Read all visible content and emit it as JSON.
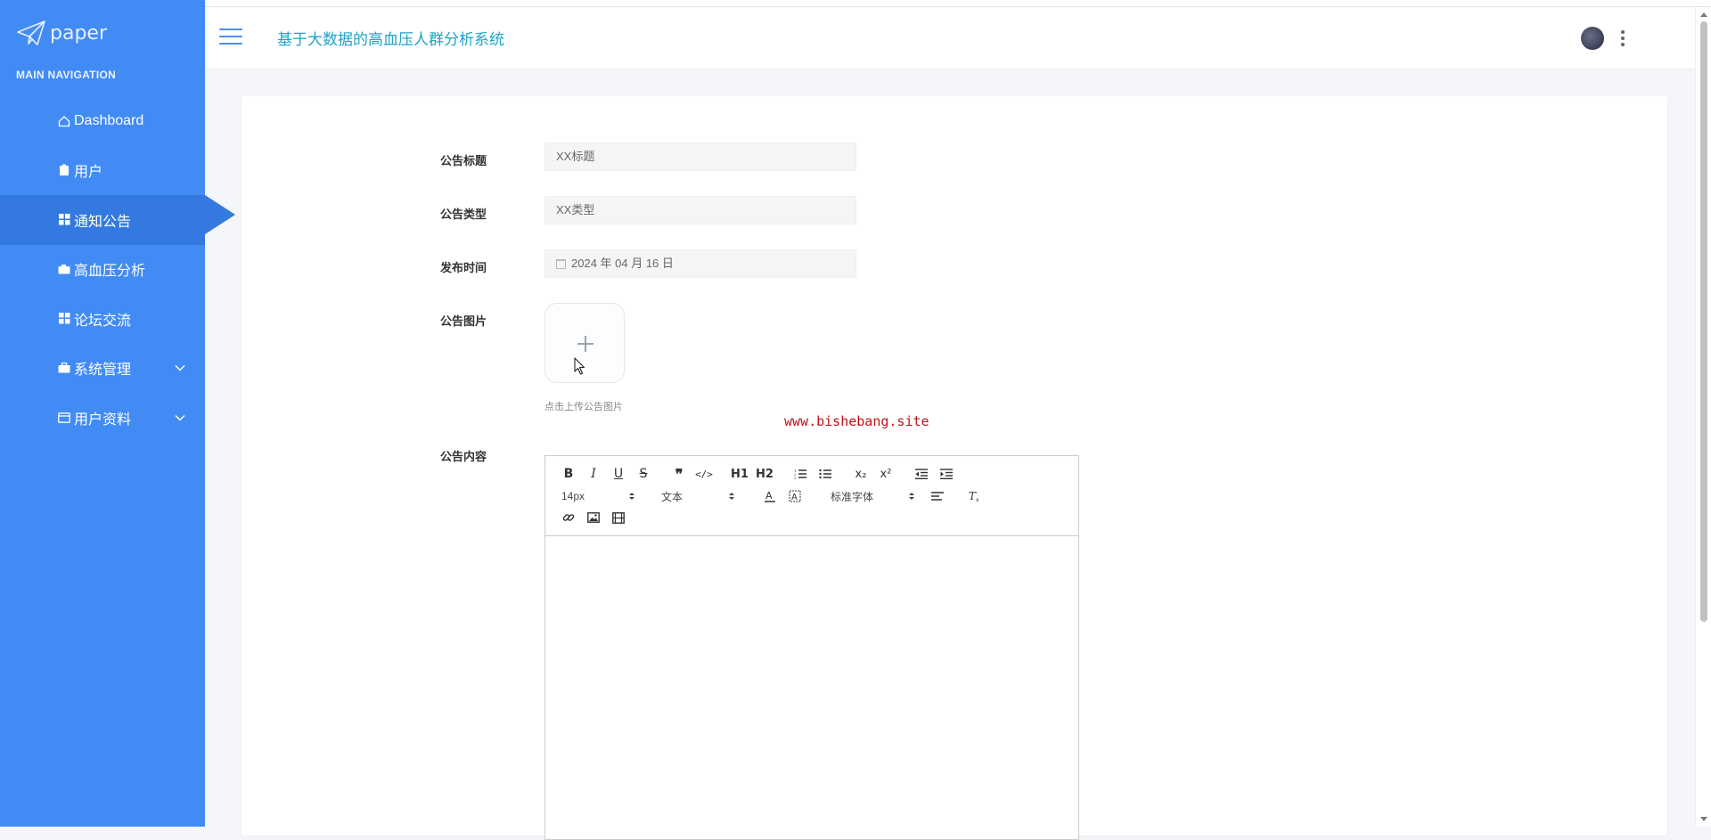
{
  "sidebar": {
    "logo_text": "paper",
    "nav_title": "MAIN NAVIGATION",
    "items": [
      {
        "label": "Dashboard",
        "icon": "home-icon",
        "active": false
      },
      {
        "label": "用户",
        "icon": "clipboard-icon",
        "active": false
      },
      {
        "label": "通知公告",
        "icon": "grid-icon",
        "active": true
      },
      {
        "label": "高血压分析",
        "icon": "camera-icon",
        "active": false
      },
      {
        "label": "论坛交流",
        "icon": "grid-icon",
        "active": false
      },
      {
        "label": "系统管理",
        "icon": "briefcase-icon",
        "active": false,
        "expandable": true
      },
      {
        "label": "用户资料",
        "icon": "card-icon",
        "active": false,
        "expandable": true
      }
    ],
    "color": "#428bf4"
  },
  "header": {
    "title": "基于大数据的高血压人群分析系统",
    "title_color": "#1ea3c8"
  },
  "form": {
    "title_label": "公告标题",
    "title_value": "XX标题",
    "type_label": "公告类型",
    "type_value": "XX类型",
    "date_label": "发布时间",
    "date_value": "2024 年 04 月 16 日",
    "image_label": "公告图片",
    "upload_hint": "点击上传公告图片",
    "content_label": "公告内容"
  },
  "watermark": "www.bishebang.site",
  "editor": {
    "row1": [
      "B",
      "I",
      "U",
      "S",
      "❞",
      "</>",
      "H1",
      "H2",
      "ol",
      "ul",
      "x₂",
      "x²",
      "outdent",
      "indent"
    ],
    "font_size": "14px",
    "header_select": "文本",
    "font_family": "标准字体"
  }
}
